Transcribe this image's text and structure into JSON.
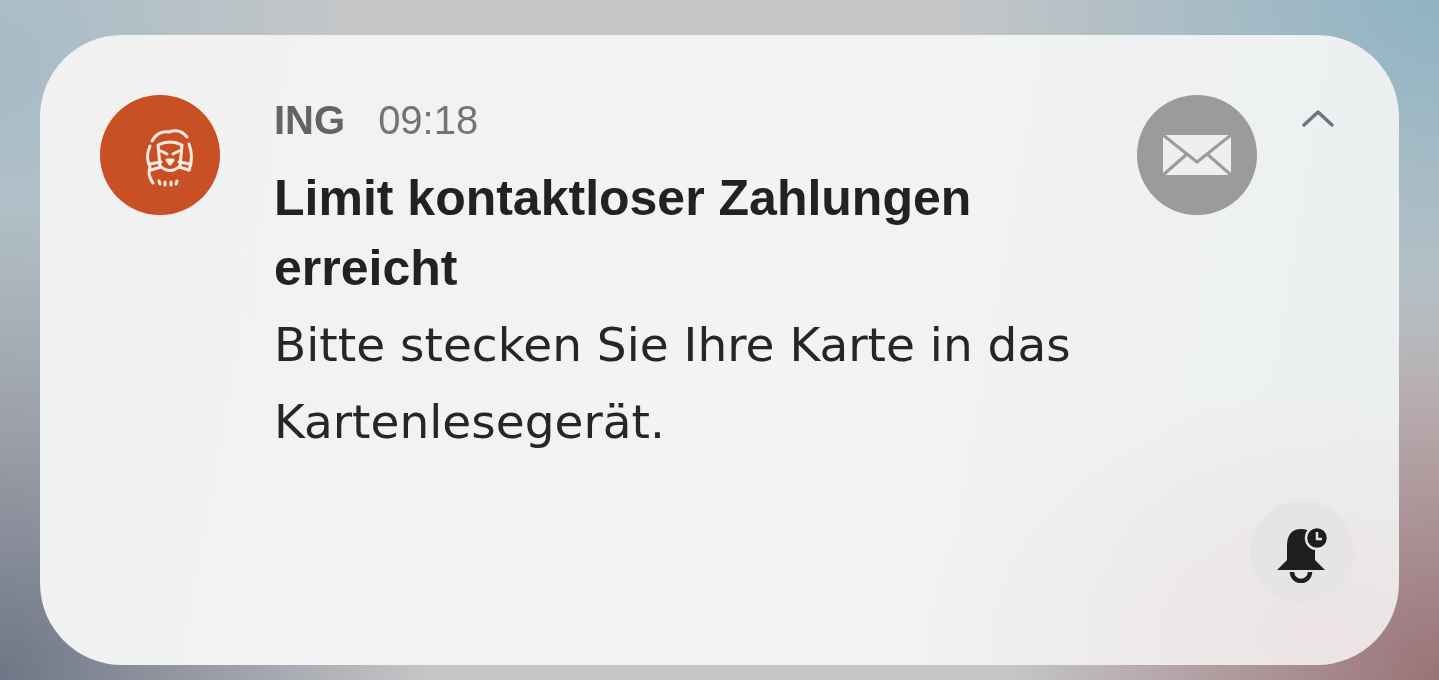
{
  "notification": {
    "app_name": "ING",
    "time": "09:18",
    "title": "Limit kontaktloser Zahlungen erreicht",
    "body": "Bitte stecken Sie Ihre Karte in das Kartenlesegerät.",
    "expanded": true
  }
}
